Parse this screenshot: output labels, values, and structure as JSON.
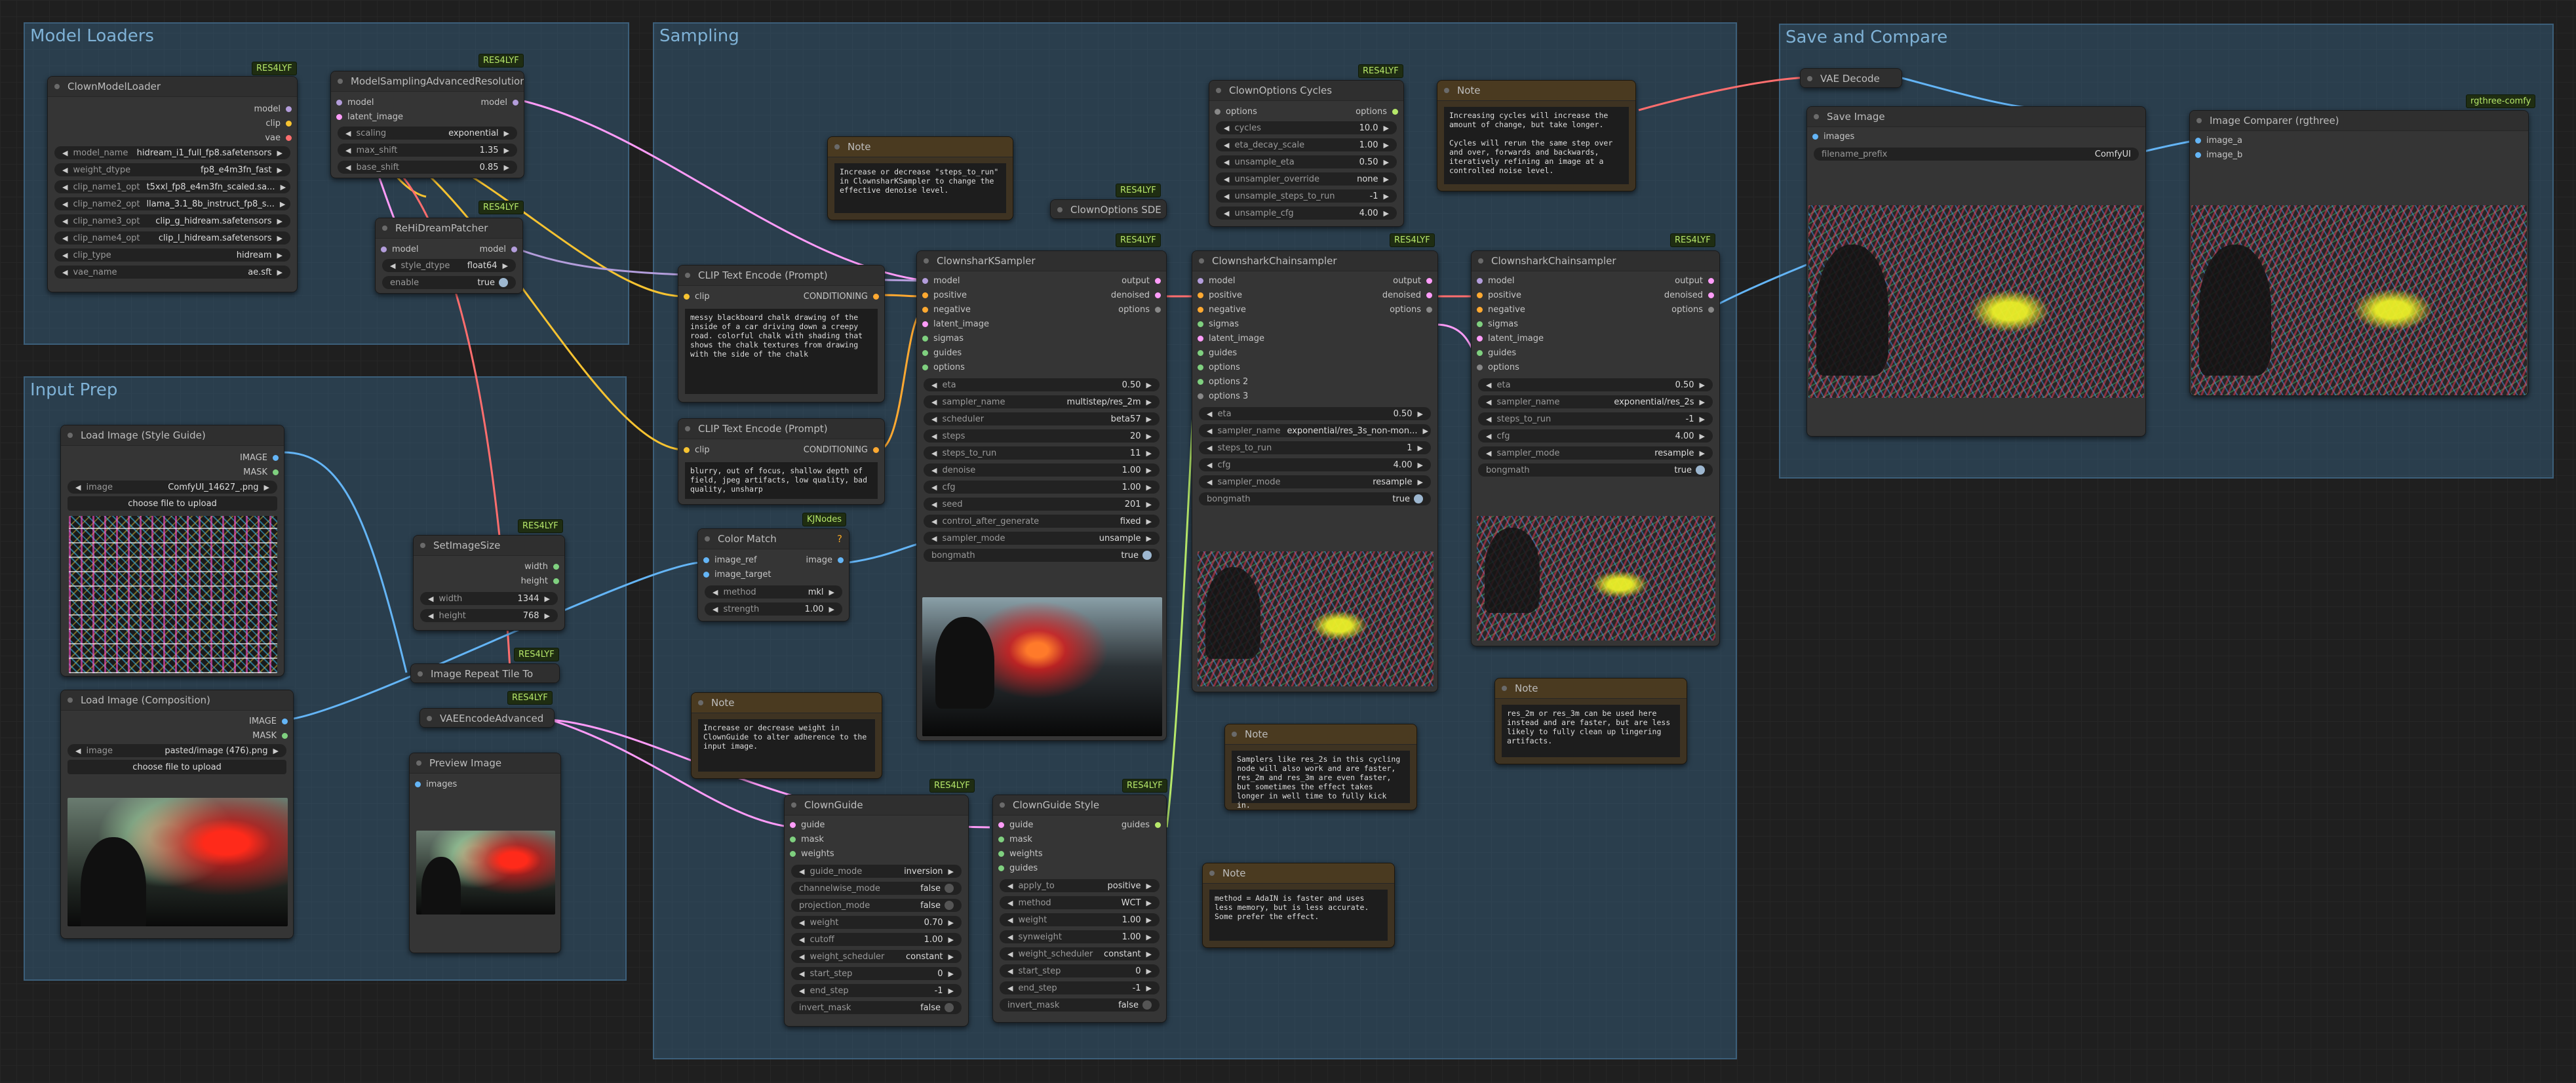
{
  "groups": {
    "model_loaders": "Model Loaders",
    "input_prep": "Input Prep",
    "sampling": "Sampling",
    "save_compare": "Save and Compare"
  },
  "badges": {
    "res4lyf": "RES4LYF",
    "kjnodes": "KJNodes",
    "rgthree": "rgthree-comfy",
    "warn": "?"
  },
  "clown_model_loader": {
    "title": "ClownModelLoader",
    "outputs": [
      "model",
      "clip",
      "vae"
    ],
    "widgets": [
      {
        "label": "model_name",
        "value": "hidream_i1_full_fp8.safetensors"
      },
      {
        "label": "weight_dtype",
        "value": "fp8_e4m3fn_fast"
      },
      {
        "label": "clip_name1_opt",
        "value": "t5xxl_fp8_e4m3fn_scaled.sa..."
      },
      {
        "label": "clip_name2_opt",
        "value": "llama_3.1_8b_instruct_fp8_s..."
      },
      {
        "label": "clip_name3_opt",
        "value": "clip_g_hidream.safetensors"
      },
      {
        "label": "clip_name4_opt",
        "value": "clip_l_hidream.safetensors"
      },
      {
        "label": "clip_type",
        "value": "hidream"
      },
      {
        "label": "vae_name",
        "value": "ae.sft"
      }
    ]
  },
  "model_sampling": {
    "title": "ModelSamplingAdvancedResolution",
    "inputs": [
      "model",
      "latent_image"
    ],
    "output": "model",
    "widgets": [
      {
        "label": "scaling",
        "value": "exponential"
      },
      {
        "label": "max_shift",
        "value": "1.35"
      },
      {
        "label": "base_shift",
        "value": "0.85"
      }
    ]
  },
  "redream_patcher": {
    "title": "ReHiDreamPatcher",
    "input": "model",
    "output": "model",
    "widgets": [
      {
        "label": "style_dtype",
        "value": "float64"
      },
      {
        "label": "enable",
        "value": "true"
      }
    ]
  },
  "load_style": {
    "title": "Load Image (Style Guide)",
    "outputs": [
      "IMAGE",
      "MASK"
    ],
    "image_label": "image",
    "image_value": "ComfyUI_14627_.png",
    "upload": "choose file to upload"
  },
  "load_comp": {
    "title": "Load Image (Composition)",
    "outputs": [
      "IMAGE",
      "MASK"
    ],
    "image_label": "image",
    "image_value": "pasted/image (476).png",
    "upload": "choose file to upload"
  },
  "set_image_size": {
    "title": "SetImageSize",
    "outputs": [
      "width",
      "height"
    ],
    "widgets": [
      {
        "label": "width",
        "value": "1344"
      },
      {
        "label": "height",
        "value": "768"
      }
    ]
  },
  "image_repeat": {
    "title": "Image Repeat Tile To"
  },
  "vae_encode_adv": {
    "title": "VAEEncodeAdvanced"
  },
  "preview_image": {
    "title": "Preview Image",
    "input": "images"
  },
  "color_match": {
    "title": "Color Match",
    "inputs": [
      "image_ref",
      "image_target"
    ],
    "output": "image",
    "widgets": [
      {
        "label": "method",
        "value": "mkl"
      },
      {
        "label": "strength",
        "value": "1.00"
      }
    ]
  },
  "clip_pos": {
    "title": "CLIP Text Encode (Prompt)",
    "input": "clip",
    "output": "CONDITIONING",
    "text": "messy blackboard chalk drawing of the inside of a car driving down a creepy road. colorful chalk with shading that shows the chalk textures from drawing with the side of the chalk"
  },
  "clip_neg": {
    "title": "CLIP Text Encode (Prompt)",
    "input": "clip",
    "output": "CONDITIONING",
    "text": "blurry, out of focus, shallow depth of field, jpeg artifacts, low quality, bad quality, unsharp"
  },
  "notes": {
    "title": "Note",
    "steps": "Increase or decrease \"steps_to_run\" in ClownsharKSampler to change the effective denoise level.",
    "weight": "Increase or decrease weight in ClownGuide to alter adherence to the input image.",
    "cycles": "Increasing cycles will increase the amount of change, but take longer.\n\nCycles will rerun the same step over and over, forwards and backwards, iteratively refining an image at a controlled noise level.",
    "samplers": "Samplers like res_2s in this cycling node will also work and are faster, res_2m and res_3m are even faster, but sometimes the effect takes longer in well time to fully kick in.",
    "res": "res_2m or res_3m can be used here instead and are faster, but are less likely to fully clean up lingering artifacts.",
    "method": "method = AdaIN is faster and uses less memory, but is less accurate. Some prefer the effect."
  },
  "clown_options_sde": {
    "title": "ClownOptions SDE"
  },
  "clown_options_cycles": {
    "title": "ClownOptions Cycles",
    "input": "options",
    "output": "options",
    "widgets": [
      {
        "label": "cycles",
        "value": "10.0"
      },
      {
        "label": "eta_decay_scale",
        "value": "1.00"
      },
      {
        "label": "unsample_eta",
        "value": "0.50"
      },
      {
        "label": "unsampler_override",
        "value": "none"
      },
      {
        "label": "unsample_steps_to_run",
        "value": "-1"
      },
      {
        "label": "unsample_cfg",
        "value": "4.00"
      }
    ]
  },
  "sampler1": {
    "title": "ClownsharKSampler",
    "inputs": [
      "model",
      "positive",
      "negative",
      "latent_image",
      "sigmas",
      "guides",
      "options"
    ],
    "outputs": [
      "output",
      "denoised",
      "options"
    ],
    "widgets": [
      {
        "label": "eta",
        "value": "0.50"
      },
      {
        "label": "sampler_name",
        "value": "multistep/res_2m"
      },
      {
        "label": "scheduler",
        "value": "beta57"
      },
      {
        "label": "steps",
        "value": "20"
      },
      {
        "label": "steps_to_run",
        "value": "11"
      },
      {
        "label": "denoise",
        "value": "1.00"
      },
      {
        "label": "cfg",
        "value": "1.00"
      },
      {
        "label": "seed",
        "value": "201"
      },
      {
        "label": "control_after_generate",
        "value": "fixed"
      },
      {
        "label": "sampler_mode",
        "value": "unsample"
      },
      {
        "label": "bongmath",
        "value": "true"
      }
    ]
  },
  "sampler2": {
    "title": "ClownsharkChainsampler",
    "inputs": [
      "model",
      "positive",
      "negative",
      "sigmas",
      "latent_image",
      "guides",
      "options",
      "options 2",
      "options 3"
    ],
    "outputs": [
      "output",
      "denoised",
      "options"
    ],
    "widgets": [
      {
        "label": "eta",
        "value": "0.50"
      },
      {
        "label": "sampler_name",
        "value": "exponential/res_3s_non-mon..."
      },
      {
        "label": "steps_to_run",
        "value": "1"
      },
      {
        "label": "cfg",
        "value": "4.00"
      },
      {
        "label": "sampler_mode",
        "value": "resample"
      },
      {
        "label": "bongmath",
        "value": "true"
      }
    ]
  },
  "sampler3": {
    "title": "ClownsharkChainsampler",
    "inputs": [
      "model",
      "positive",
      "negative",
      "sigmas",
      "latent_image",
      "guides",
      "options"
    ],
    "outputs": [
      "output",
      "denoised",
      "options"
    ],
    "widgets": [
      {
        "label": "eta",
        "value": "0.50"
      },
      {
        "label": "sampler_name",
        "value": "exponential/res_2s"
      },
      {
        "label": "steps_to_run",
        "value": "-1"
      },
      {
        "label": "cfg",
        "value": "4.00"
      },
      {
        "label": "sampler_mode",
        "value": "resample"
      },
      {
        "label": "bongmath",
        "value": "true"
      }
    ]
  },
  "clown_guide": {
    "title": "ClownGuide",
    "inputs": [
      "guide",
      "mask",
      "weights"
    ],
    "widgets": [
      {
        "label": "guide_mode",
        "value": "inversion"
      },
      {
        "label": "channelwise_mode",
        "value": "false"
      },
      {
        "label": "projection_mode",
        "value": "false"
      },
      {
        "label": "weight",
        "value": "0.70"
      },
      {
        "label": "cutoff",
        "value": "1.00"
      },
      {
        "label": "weight_scheduler",
        "value": "constant"
      },
      {
        "label": "start_step",
        "value": "0"
      },
      {
        "label": "end_step",
        "value": "-1"
      },
      {
        "label": "invert_mask",
        "value": "false"
      }
    ]
  },
  "clown_guide_style": {
    "title": "ClownGuide Style",
    "inputs": [
      "guide",
      "mask",
      "weights",
      "guides"
    ],
    "output": "guides",
    "widgets": [
      {
        "label": "apply_to",
        "value": "positive"
      },
      {
        "label": "method",
        "value": "WCT"
      },
      {
        "label": "weight",
        "value": "1.00"
      },
      {
        "label": "synweight",
        "value": "1.00"
      },
      {
        "label": "weight_scheduler",
        "value": "constant"
      },
      {
        "label": "start_step",
        "value": "0"
      },
      {
        "label": "end_step",
        "value": "-1"
      },
      {
        "label": "invert_mask",
        "value": "false"
      }
    ]
  },
  "vae_decode": {
    "title": "VAE Decode"
  },
  "save_image": {
    "title": "Save Image",
    "input": "images",
    "widget": {
      "label": "filename_prefix",
      "value": "ComfyUI"
    }
  },
  "image_comparer": {
    "title": "Image Comparer (rgthree)",
    "inputs": [
      "image_a",
      "image_b"
    ]
  },
  "colors": {
    "group_fill": "#3a698c",
    "model_wire": "#b39ddb",
    "clip_wire": "#f7c331",
    "image_wire": "#64b5f6",
    "latent_wire": "#ff9cf9",
    "cond_wire": "#ffa931",
    "vae_wire": "#ff6e6e",
    "badge_text": "#b6e86a"
  }
}
